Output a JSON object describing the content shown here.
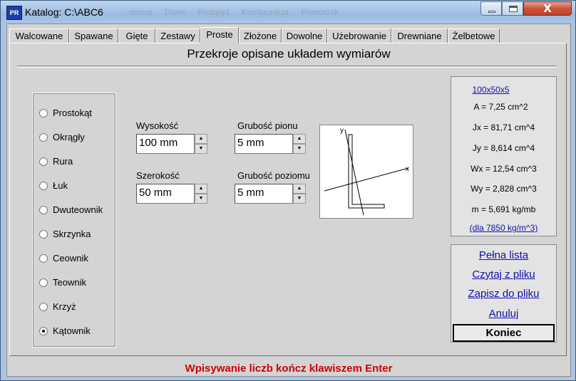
{
  "window": {
    "title": "Katalog: C:\\ABC6",
    "icon_text": "PR",
    "ghost_menu": [
      "...ocena",
      "Dane",
      "Podgląd",
      "Konfiguracja",
      "Pomocnik"
    ],
    "close_symbol": "X"
  },
  "tabs": [
    {
      "label": "Walcowane",
      "active": false
    },
    {
      "label": "Spawane",
      "active": false
    },
    {
      "label": "Gięte",
      "active": false
    },
    {
      "label": "Zestawy",
      "active": false
    },
    {
      "label": "Proste",
      "active": true
    },
    {
      "label": "Złożone",
      "active": false
    },
    {
      "label": "Dowolne",
      "active": false
    },
    {
      "label": "Użebrowanie",
      "active": false
    },
    {
      "label": "Drewniane",
      "active": false
    },
    {
      "label": "Żelbetowe",
      "active": false
    }
  ],
  "heading": "Przekroje opisane układem wymiarów",
  "shapes": [
    {
      "label": "Prostokąt",
      "selected": false
    },
    {
      "label": "Okrągły",
      "selected": false
    },
    {
      "label": "Rura",
      "selected": false
    },
    {
      "label": "Łuk",
      "selected": false
    },
    {
      "label": "Dwuteownik",
      "selected": false
    },
    {
      "label": "Skrzynka",
      "selected": false
    },
    {
      "label": "Ceownik",
      "selected": false
    },
    {
      "label": "Teownik",
      "selected": false
    },
    {
      "label": "Krzyż",
      "selected": false
    },
    {
      "label": "Kątownik",
      "selected": true
    }
  ],
  "fields": {
    "height": {
      "label": "Wysokość",
      "value": "100 mm"
    },
    "width": {
      "label": "Szerokość",
      "value": "50 mm"
    },
    "web_thickness": {
      "label": "Grubość pionu",
      "value": "5 mm"
    },
    "flange_thickness": {
      "label": "Grubość poziomu",
      "value": "5 mm"
    }
  },
  "preview": {
    "axis_x": "x",
    "axis_y": "y"
  },
  "properties": {
    "name": "100x50x5",
    "A": "A = 7,25 cm^2",
    "Jx": "Jx = 81,71 cm^4",
    "Jy": "Jy = 8,614 cm^4",
    "Wx": "Wx = 12,54 cm^3",
    "Wy": "Wy = 2,828 cm^3",
    "m": "m = 5,691 kg/mb",
    "density": "(dla 7850 kg/m^3)"
  },
  "actions": {
    "full_list": "Pełna lista",
    "read_file": "Czytaj z pliku",
    "save_file": "Zapisz do pliku",
    "cancel": "Anuluj",
    "end": "Koniec"
  },
  "status": "Wpisywanie liczb kończ klawiszem Enter"
}
